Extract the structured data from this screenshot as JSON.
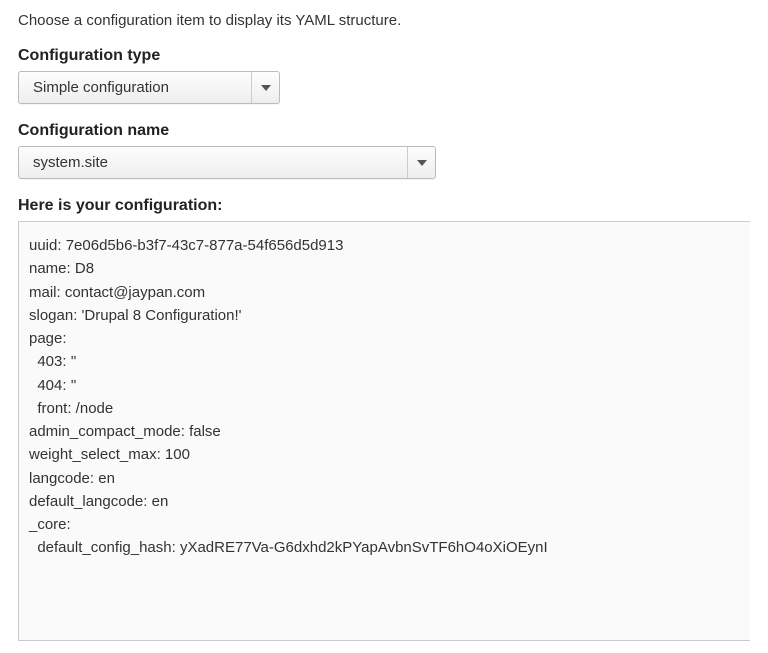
{
  "intro": "Choose a configuration item to display its YAML structure.",
  "config_type": {
    "label": "Configuration type",
    "value": "Simple configuration"
  },
  "config_name": {
    "label": "Configuration name",
    "value": "system.site"
  },
  "output": {
    "label": "Here is your configuration:",
    "yaml": "uuid: 7e06d5b6-b3f7-43c7-877a-54f656d5d913\nname: D8\nmail: contact@jaypan.com\nslogan: 'Drupal 8 Configuration!'\npage:\n  403: ''\n  404: ''\n  front: /node\nadmin_compact_mode: false\nweight_select_max: 100\nlangcode: en\ndefault_langcode: en\n_core:\n  default_config_hash: yXadRE77Va-G6dxhd2kPYapAvbnSvTF6hO4oXiOEynI"
  }
}
